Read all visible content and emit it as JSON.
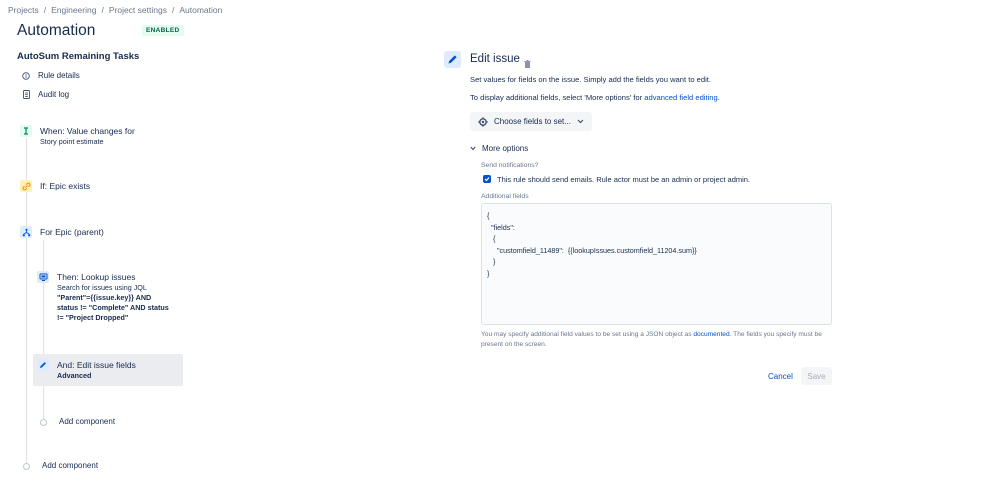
{
  "breadcrumb": {
    "items": [
      "Projects",
      "Engineering",
      "Project settings",
      "Automation"
    ],
    "separator": "/"
  },
  "header": {
    "title": "Automation",
    "status_badge": "ENABLED"
  },
  "sidebar": {
    "rule_name": "AutoSum Remaining Tasks",
    "links": [
      {
        "label": "Rule details",
        "icon": "info-icon"
      },
      {
        "label": "Audit log",
        "icon": "document-icon"
      }
    ]
  },
  "flow": {
    "trigger": {
      "title": "When: Value changes for",
      "sub": "Story point estimate",
      "icon": "trigger-icon",
      "color": "#00875a"
    },
    "condition": {
      "title": "If: Epic exists",
      "icon": "link-icon",
      "color": "#ff991f"
    },
    "branch": {
      "title": "For Epic (parent)",
      "icon": "branch-icon",
      "color": "#0052cc"
    },
    "lookup": {
      "title": "Then: Lookup issues",
      "sub_line1": "Search for issues using JQL",
      "sub_bold1": "\"Parent\"={{issue.key}} AND",
      "sub_bold2": "status != \"Complete\" AND status",
      "sub_bold3": "!= \"Project Dropped\"",
      "icon": "monitor-icon"
    },
    "edit": {
      "title": "And: Edit issue fields",
      "sub": "Advanced",
      "icon": "pencil-icon"
    },
    "add_inner": "Add component",
    "add_outer": "Add component"
  },
  "panel": {
    "title": "Edit issue",
    "desc1": "Set values for fields on the issue. Simply add the fields you want to edit.",
    "desc2_prefix": "To display additional fields, select 'More options' for ",
    "desc2_link": "advanced field editing",
    "desc2_suffix": ".",
    "choose_button": "Choose fields to set...",
    "more_options": "More options",
    "send_notifications_label": "Send notifications?",
    "checkbox_label": "This rule should send emails. Rule actor must be an admin or project admin.",
    "checkbox_checked": true,
    "additional_fields_label": "Additional fields",
    "json_value": "{\n  \"fields\":\n   {\n     \"customfield_11489\":  {{lookupIssues.customfield_11204.sum}}\n   }\n}",
    "help_prefix": "You may specify additional field values to be set using a JSON object as ",
    "help_link": "documented",
    "help_suffix": ". The fields you specify must be present on the screen.",
    "cancel": "Cancel",
    "save": "Save"
  },
  "colors": {
    "accent": "#0052cc",
    "badge_bg": "#e3fcef",
    "badge_text": "#006644"
  }
}
